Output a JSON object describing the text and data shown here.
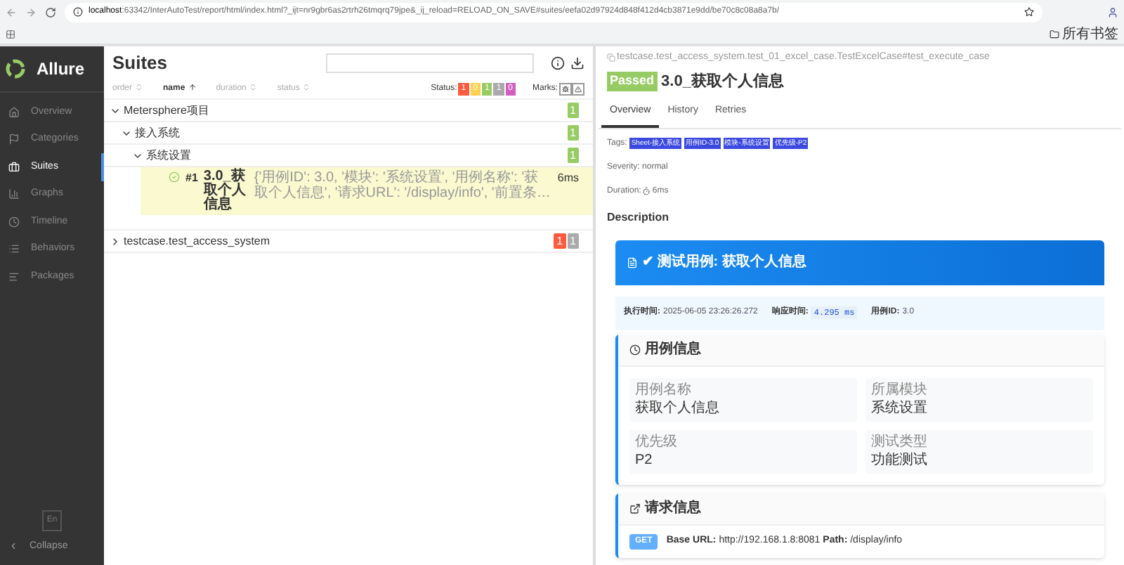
{
  "browser": {
    "url_host": "localhost",
    "url_rest": ":63342/InterAutoTest/report/html/index.html?_ijt=nr9gbr6as2rtrh26tmqrq79jpe&_ij_reload=RELOAD_ON_SAVE#suites/eefa02d97924d848f412d4cb3871e9dd/be70c8c08a8a7b/",
    "bookmarks": "所有书签"
  },
  "sidebar": {
    "brand": "Allure",
    "items": [
      {
        "label": "Overview",
        "kind": "home",
        "selected": false
      },
      {
        "label": "Categories",
        "kind": "flag",
        "selected": false
      },
      {
        "label": "Suites",
        "kind": "briefcase",
        "selected": true
      },
      {
        "label": "Graphs",
        "kind": "chart",
        "selected": false
      },
      {
        "label": "Timeline",
        "kind": "clock",
        "selected": false
      },
      {
        "label": "Behaviors",
        "kind": "list",
        "selected": false
      },
      {
        "label": "Packages",
        "kind": "align",
        "selected": false
      }
    ],
    "language": "En",
    "collapse": "Collapse"
  },
  "suites": {
    "title": "Suites",
    "sort": [
      {
        "label": "order",
        "selected": false
      },
      {
        "label": "name",
        "selected": true
      },
      {
        "label": "duration",
        "selected": false
      },
      {
        "label": "status",
        "selected": false
      }
    ],
    "status_label": "Status:",
    "status_counts": [
      {
        "count": "1",
        "color": "#fd5a3e"
      },
      {
        "count": "0",
        "color": "#ffd050"
      },
      {
        "count": "1",
        "color": "#97cc64"
      },
      {
        "count": "1",
        "color": "#aaaaaa"
      },
      {
        "count": "0",
        "color": "#d35ebe"
      }
    ],
    "marks_label": "Marks:",
    "tree": [
      {
        "name": "Metersphere项目",
        "expanded": true,
        "counts": [
          {
            "count": "1",
            "color": "#97cc64"
          }
        ],
        "children": [
          {
            "name": "接入系统",
            "expanded": true,
            "counts": [
              {
                "count": "1",
                "color": "#97cc64"
              }
            ],
            "children": [
              {
                "name": "系统设置",
                "expanded": true,
                "counts": [
                  {
                    "count": "1",
                    "color": "#97cc64"
                  }
                ],
                "cases": [
                  {
                    "number": "#1",
                    "name": "3.0_获取个人信息",
                    "description": "{'用例ID': 3.0, '模块': '系统设置', '用例名称': '获取个人信息', '请求URL': '/display/info', '前置条…",
                    "duration": "6ms",
                    "selected": true
                  }
                ]
              }
            ]
          }
        ]
      },
      {
        "name": "testcase.test_access_system",
        "expanded": false,
        "counts": [
          {
            "count": "1",
            "color": "#fd5a3e"
          },
          {
            "count": "1",
            "color": "#aaaaaa"
          }
        ]
      }
    ]
  },
  "detail": {
    "path": "testcase.test_access_system.test_01_excel_case.TestExcelCase#test_execute_case",
    "status": "Passed",
    "title": "3.0_获取个人信息",
    "tabs": [
      {
        "label": "Overview",
        "selected": true
      },
      {
        "label": "History",
        "selected": false
      },
      {
        "label": "Retries",
        "selected": false
      }
    ],
    "tags_label": "Tags:",
    "tags": [
      "Sheet-接入系统",
      "用例ID-3.0",
      "模块-系统设置",
      "优先级-P2"
    ],
    "severity_label": "Severity:",
    "severity": "normal",
    "duration_label": "Duration:",
    "duration": "6ms",
    "description_heading": "Description",
    "banner": "✔ 测试用例: 获取个人信息",
    "meta": [
      {
        "label": "执行时间:",
        "value": "2025-06-05 23:26:26.272",
        "kind": "text"
      },
      {
        "label": "响应时间:",
        "value": "4.295 ms",
        "kind": "code"
      },
      {
        "label": "用例ID:",
        "value": "3.0",
        "kind": "text"
      }
    ],
    "case_info": {
      "heading": "用例信息",
      "fields": [
        {
          "label": "用例名称",
          "value": "获取个人信息"
        },
        {
          "label": "所属模块",
          "value": "系统设置"
        },
        {
          "label": "优先级",
          "value": "P2"
        },
        {
          "label": "测试类型",
          "value": "功能测试"
        }
      ]
    },
    "request_info": {
      "heading": "请求信息",
      "method": "GET",
      "line": "**Base URL:** http://192.168.1.8:8081 **Path:** /display/info"
    }
  }
}
